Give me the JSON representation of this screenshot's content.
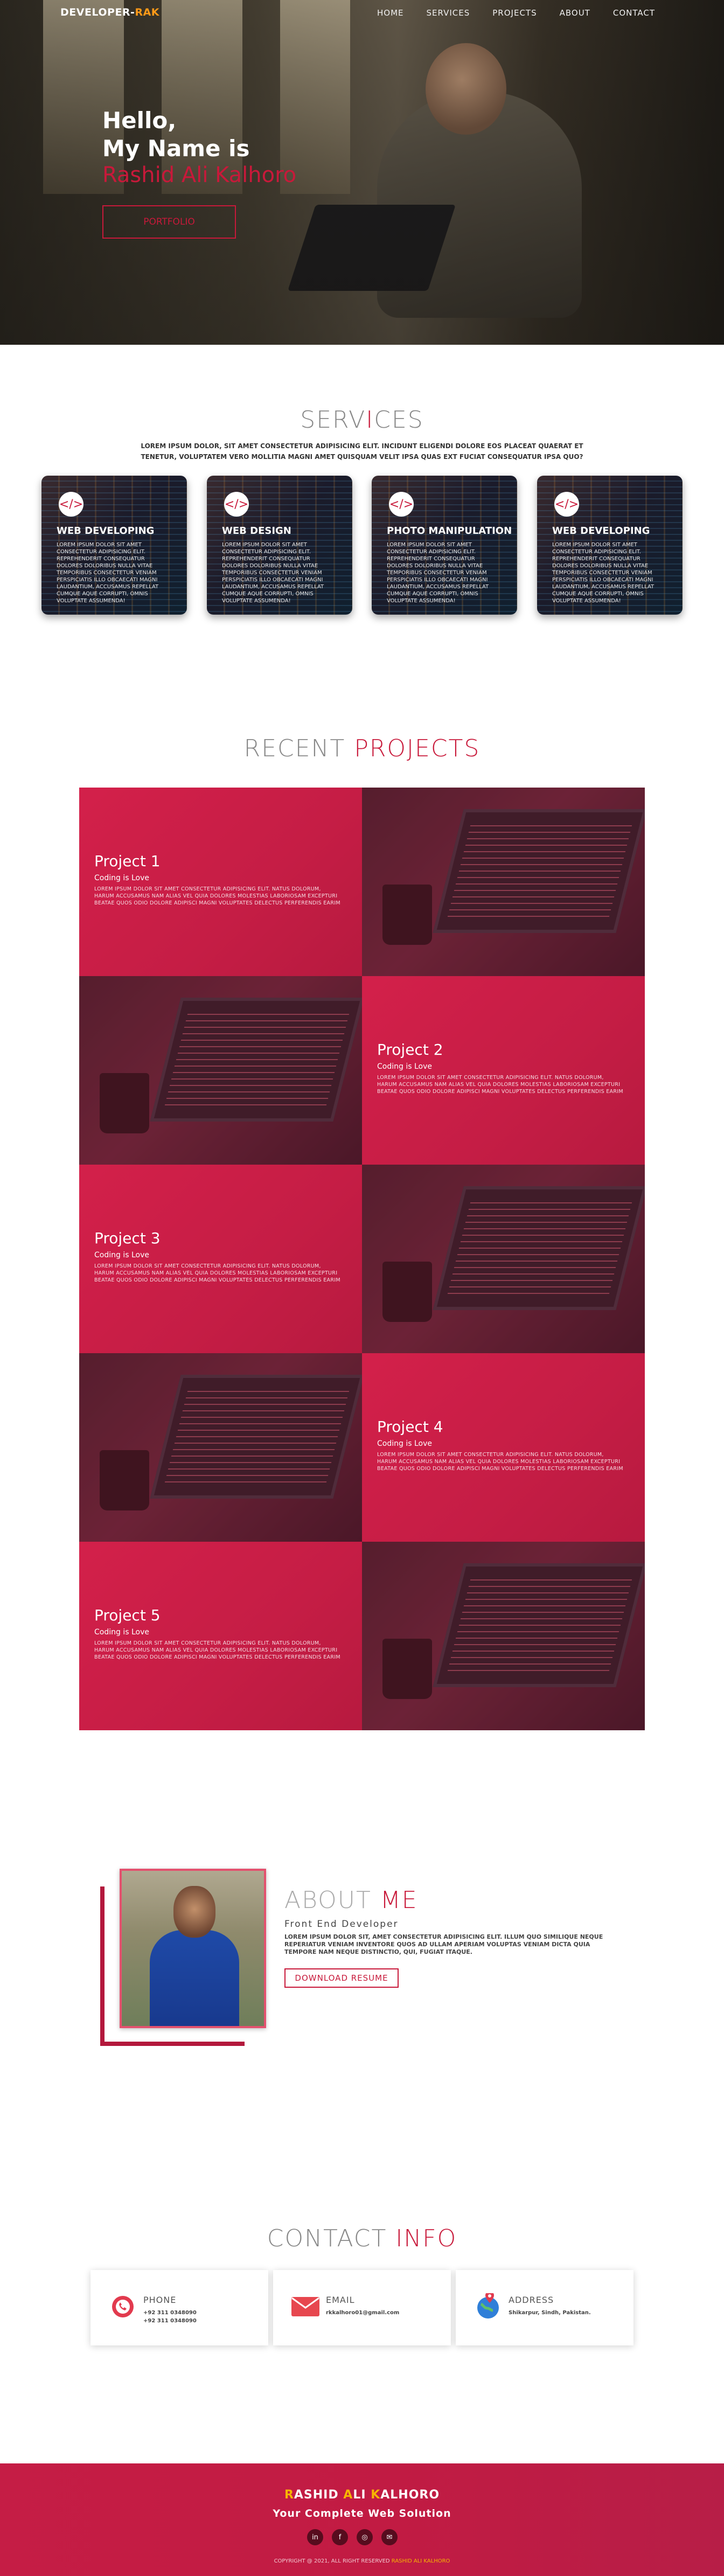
{
  "nav": {
    "logo_main": "DEVELOPER-",
    "logo_accent": "RAK",
    "items": [
      "HOME",
      "SERVICES",
      "PROJECTS",
      "ABOUT",
      "CONTACT"
    ]
  },
  "hero": {
    "hello": "Hello,",
    "intro": "My Name is",
    "name": "Rashid Ali Kalhoro",
    "button": "PORTFOLIO"
  },
  "services": {
    "title_a": "SERV",
    "title_b": "I",
    "title_c": "CES",
    "description": "LOREM IPSUM DOLOR, SIT AMET CONSECTETUR ADIPISICING ELIT. INCIDUNT ELIGENDI DOLORE EOS PLACEAT QUAERAT ET TENETUR, VOLUPTATEM VERO MOLLITIA MAGNI AMET QUISQUAM VELIT IPSA QUAS EXT FUCIAT CONSEQUATUR IPSA QUO?",
    "cards": [
      {
        "title": "WEB DEVELOPING",
        "text": "LOREM IPSUM DOLOR SIT AMET CONSECTETUR ADIPISICING ELIT. REPREHENDERIT CONSEQUATUR DOLORES DOLORIBUS NULLA VITAE TEMPORIBUS CONSECTETUR VENIAM PERSPICIATIS ILLO OBCAECATI MAGNI LAUDANTIUM, ACCUSAMUS REPELLAT CUMQUE AQUE CORRUPTI, OMNIS VOLUPTATE ASSUMENDA!"
      },
      {
        "title": "WEB DESIGN",
        "text": "LOREM IPSUM DOLOR SIT AMET CONSECTETUR ADIPISICING ELIT. REPREHENDERIT CONSEQUATUR DOLORES DOLORIBUS NULLA VITAE TEMPORIBUS CONSECTETUR VENIAM PERSPICIATIS ILLO OBCAECATI MAGNI LAUDANTIUM, ACCUSAMUS REPELLAT CUMQUE AQUE CORRUPTI, OMNIS VOLUPTATE ASSUMENDA!"
      },
      {
        "title": "PHOTO MANIPULATION",
        "text": "LOREM IPSUM DOLOR SIT AMET CONSECTETUR ADIPISICING ELIT. REPREHENDERIT CONSEQUATUR DOLORES DOLORIBUS NULLA VITAE TEMPORIBUS CONSECTETUR VENIAM PERSPICIATIS ILLO OBCAECATI MAGNI LAUDANTIUM, ACCUSAMUS REPELLAT CUMQUE AQUE CORRUPTI, OMNIS VOLUPTATE ASSUMENDA!"
      },
      {
        "title": "WEB DEVELOPING",
        "text": "LOREM IPSUM DOLOR SIT AMET CONSECTETUR ADIPISICING ELIT. REPREHENDERIT CONSEQUATUR DOLORES DOLORIBUS NULLA VITAE TEMPORIBUS CONSECTETUR VENIAM PERSPICIATIS ILLO OBCAECATI MAGNI LAUDANTIUM, ACCUSAMUS REPELLAT CUMQUE AQUE CORRUPTI, OMNIS VOLUPTATE ASSUMENDA!"
      }
    ]
  },
  "projects": {
    "title_plain": "RECENT ",
    "title_red": "PROJECTS",
    "items": [
      {
        "title": "Project 1",
        "subtitle": "Coding is Love",
        "text": "LOREM IPSUM DOLOR SIT AMET CONSECTETUR ADIPISICING ELIT. NATUS DOLORUM, HARUM ACCUSAMUS NAM ALIAS VEL QUIA DOLORES MOLESTIAS LABORIOSAM EXCEPTURI BEATAE QUOS ODIO DOLORE ADIPISCI MAGNI VOLUPTATES DELECTUS PERFERENDIS EARIM"
      },
      {
        "title": "Project 2",
        "subtitle": "Coding is Love",
        "text": "LOREM IPSUM DOLOR SIT AMET CONSECTETUR ADIPISICING ELIT. NATUS DOLORUM, HARUM ACCUSAMUS NAM ALIAS VEL QUIA DOLORES MOLESTIAS LABORIOSAM EXCEPTURI BEATAE QUOS ODIO DOLORE ADIPISCI MAGNI VOLUPTATES DELECTUS PERFERENDIS EARIM"
      },
      {
        "title": "Project 3",
        "subtitle": "Coding is Love",
        "text": "LOREM IPSUM DOLOR SIT AMET CONSECTETUR ADIPISICING ELIT. NATUS DOLORUM, HARUM ACCUSAMUS NAM ALIAS VEL QUIA DOLORES MOLESTIAS LABORIOSAM EXCEPTURI BEATAE QUOS ODIO DOLORE ADIPISCI MAGNI VOLUPTATES DELECTUS PERFERENDIS EARIM"
      },
      {
        "title": "Project 4",
        "subtitle": "Coding is Love",
        "text": "LOREM IPSUM DOLOR SIT AMET CONSECTETUR ADIPISICING ELIT. NATUS DOLORUM, HARUM ACCUSAMUS NAM ALIAS VEL QUIA DOLORES MOLESTIAS LABORIOSAM EXCEPTURI BEATAE QUOS ODIO DOLORE ADIPISCI MAGNI VOLUPTATES DELECTUS PERFERENDIS EARIM"
      },
      {
        "title": "Project 5",
        "subtitle": "Coding is Love",
        "text": "LOREM IPSUM DOLOR SIT AMET CONSECTETUR ADIPISICING ELIT. NATUS DOLORUM, HARUM ACCUSAMUS NAM ALIAS VEL QUIA DOLORES MOLESTIAS LABORIOSAM EXCEPTURI BEATAE QUOS ODIO DOLORE ADIPISCI MAGNI VOLUPTATES DELECTUS PERFERENDIS EARIM"
      }
    ]
  },
  "about": {
    "title_plain": "ABOUT ",
    "title_red": "ME",
    "subtitle": "Front End Developer",
    "text": "LOREM IPSUM DOLOR SIT, AMET CONSECTETUR ADIPISICING ELIT. ILLUM QUO SIMILIQUE NEQUE REPERIATUR VENIAM INVENTORE QUOS AD ULLAM APERIAM VOLUPTAS VENIAM DICTA QUIA TEMPORE NAM NEQUE DISTINCTIO, QUI, FUGIAT ITAQUE.",
    "button": "DOWNLOAD RESUME"
  },
  "contact": {
    "title_plain": "CONTACT ",
    "title_red": "INFO",
    "cards": [
      {
        "label": "PHONE",
        "line1": "+92 311 0348090",
        "line2": "+92 311 0348090",
        "icon": "phone-icon"
      },
      {
        "label": "EMAIL",
        "line1": "rkkalhoro01@gmail.com",
        "line2": "",
        "icon": "email-icon"
      },
      {
        "label": "ADDRESS",
        "line1": "Shikarpur, Sindh, Pakistan.",
        "line2": "",
        "icon": "location-icon"
      }
    ]
  },
  "footer": {
    "name_a": "R",
    "name_b": "ASHID ",
    "name_c": "A",
    "name_d": "LI ",
    "name_e": "K",
    "name_f": "ALHORO",
    "tagline": "Your Complete Web Solution",
    "social": [
      "in",
      "f",
      "◎",
      "✉"
    ],
    "copyright": "COPYRIGHT @ 2021, ALL RIGHT RESERVED ",
    "copyright_name": "RASHID ALI KALHORO"
  },
  "colors": {
    "accent": "#c8193a",
    "logo_accent": "#ff9a18",
    "footer_gold": "#f7b500"
  }
}
